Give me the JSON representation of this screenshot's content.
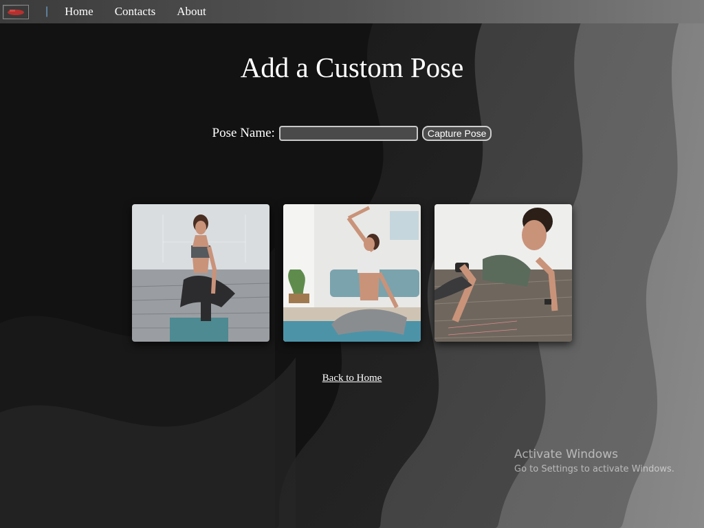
{
  "nav": {
    "separator": "|",
    "links": [
      "Home",
      "Contacts",
      "About"
    ]
  },
  "page": {
    "title": "Add a Custom Pose"
  },
  "form": {
    "label": "Pose Name:",
    "input_value": "",
    "button_label": "Capture Pose"
  },
  "gallery": {
    "images": [
      "seated-kneeling-pose-photo",
      "seated-side-stretch-pose-photo",
      "plank-pose-photo"
    ]
  },
  "back_link": "Back to Home",
  "watermark": {
    "title": "Activate Windows",
    "subtitle": "Go to Settings to activate Windows."
  },
  "colors": {
    "nav_left": "#3b3b3b",
    "nav_right": "#7b7b7b",
    "background": "#121212",
    "text": "#ffffff"
  }
}
